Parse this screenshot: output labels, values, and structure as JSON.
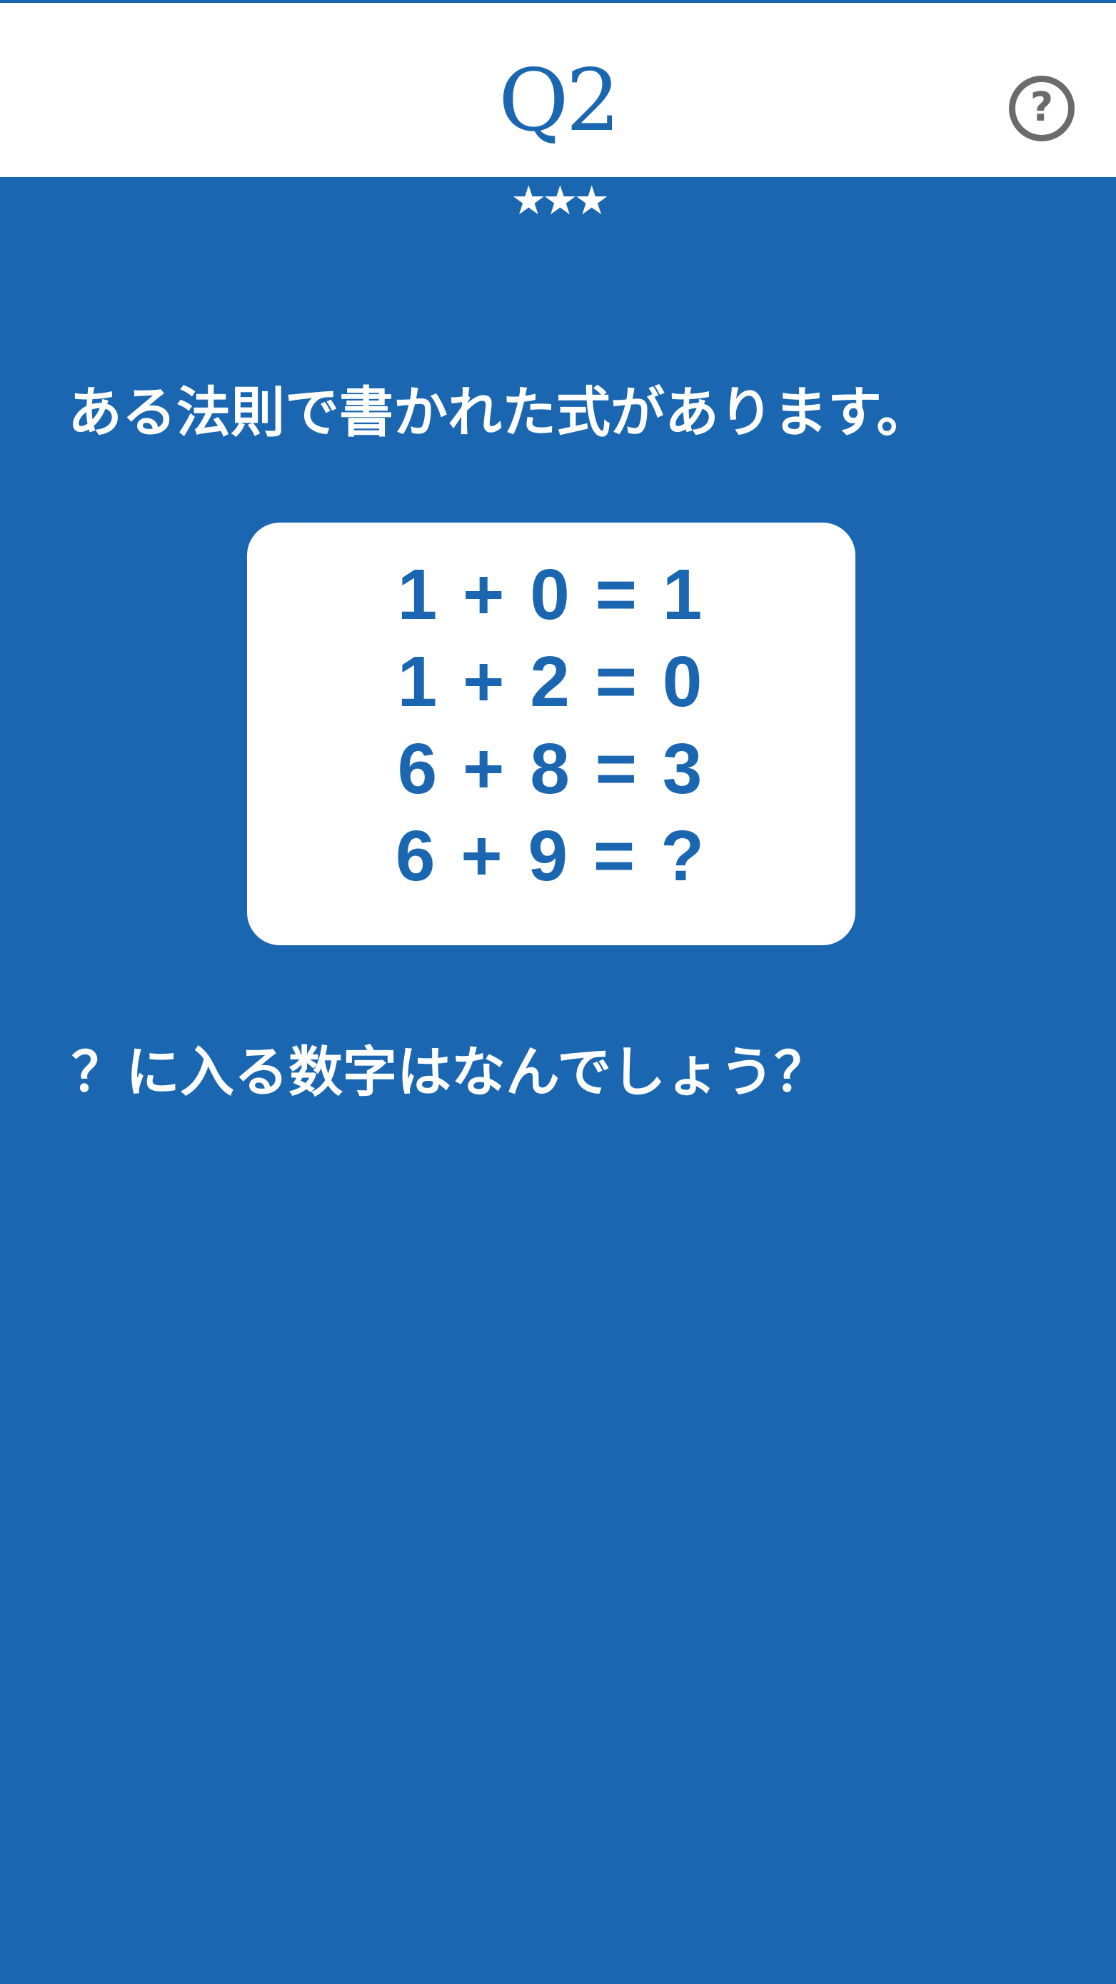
{
  "header": {
    "title": "Q2",
    "help_label": "?"
  },
  "difficulty": {
    "stars": "★★★",
    "rating": 3
  },
  "puzzle": {
    "intro": "ある法則で書かれた式があります。",
    "equations": [
      "1 + 0 = 1",
      "1 + 2 = 0",
      "6 + 8 = 3",
      "6 + 9 = ?"
    ],
    "question": "？に入る数字はなんでしょう？"
  },
  "colors": {
    "primary": "#1a66b1",
    "header_background": "#ffffff",
    "help_icon": "#6b6b6b",
    "text_light": "#ffffff"
  }
}
